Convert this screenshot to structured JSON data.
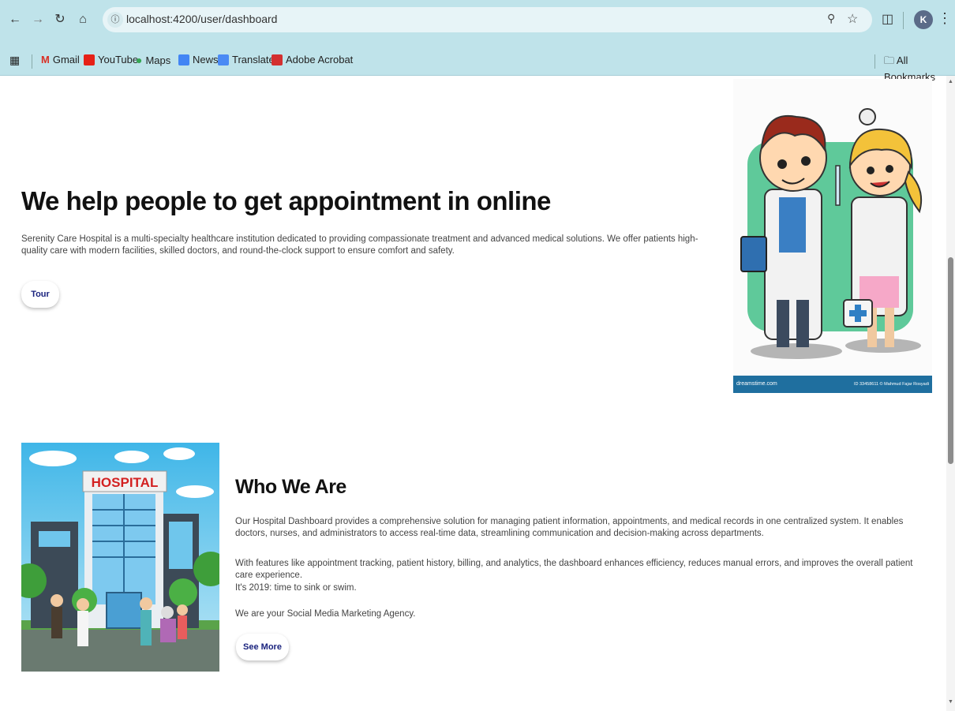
{
  "browser": {
    "url": "localhost:4200/user/dashboard",
    "avatar_letter": "K",
    "bookmarks": [
      "Gmail",
      "YouTube",
      "Maps",
      "News",
      "Translate",
      "Adobe Acrobat"
    ],
    "all_bookmarks": "All Bookmarks"
  },
  "hero": {
    "title": "We help people to get appointment in online",
    "description": "Serenity Care Hospital is a multi-specialty healthcare institution dedicated to providing compassionate treatment and advanced medical solutions. We offer patients high-quality care with modern facilities, skilled doctors, and round-the-clock support to ensure comfort and safety.",
    "button_label": "Tour"
  },
  "doctors_image": {
    "watermark": "dreamstime.com",
    "credit": "ID 33458611 © Mahmud Fajar Rosyadi"
  },
  "hospital_image": {
    "sign": "HOSPITAL"
  },
  "who_we_are": {
    "title": "Who We Are",
    "paragraphs": [
      "Our Hospital Dashboard provides a comprehensive solution for managing patient information, appointments, and medical records in one centralized system. It enables doctors, nurses, and administrators to access real-time data, streamlining communication and decision-making across departments.",
      "With features like appointment tracking, patient history, billing, and analytics, the dashboard enhances efficiency, reduces manual errors, and improves the overall patient care experience.",
      "It's 2019: time to sink or swim.",
      "We are your Social Media Marketing Agency."
    ],
    "button_label": "See More"
  }
}
